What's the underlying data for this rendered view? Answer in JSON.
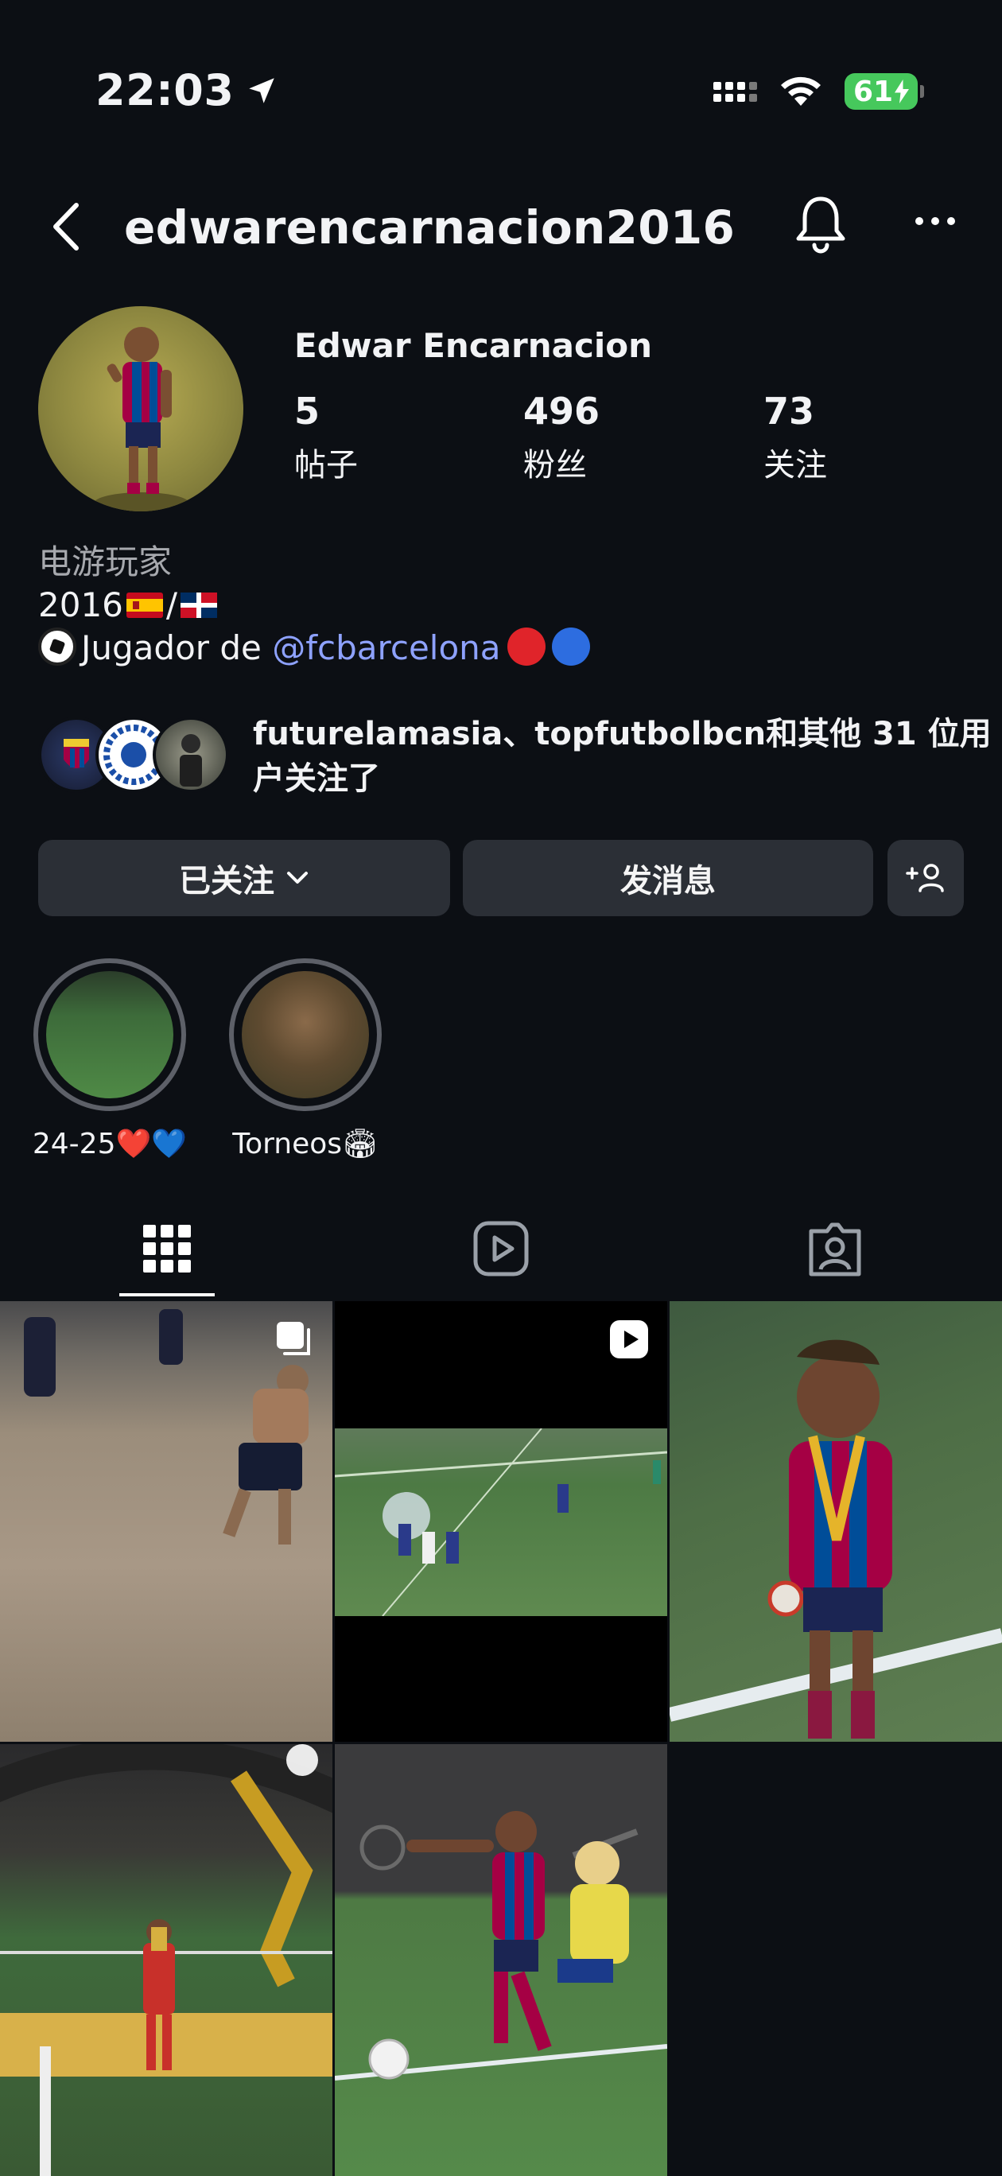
{
  "status_bar": {
    "time": "22:03",
    "battery": "61"
  },
  "header": {
    "username": "edwarencarnacion2016"
  },
  "profile": {
    "display_name": "Edwar Encarnacion",
    "stats": [
      {
        "value": "5",
        "label": "帖子"
      },
      {
        "value": "496",
        "label": "粉丝"
      },
      {
        "value": "73",
        "label": "关注"
      }
    ],
    "bio": {
      "category": "电游玩家",
      "line1_text": "2016",
      "line1_sep": "/",
      "line2_text": "Jugador de ",
      "mention": "@fcbarcelona"
    },
    "followed_by": {
      "names": "futurelamasia、topfutbolbcn",
      "rest": "和其他 31 位用户关注了"
    }
  },
  "actions": {
    "following_label": "已关注",
    "message_label": "发消息"
  },
  "highlights": [
    {
      "label": "24-25❤️💙"
    },
    {
      "label": "Torneos🏟"
    }
  ],
  "colors": {
    "background": "#0c0f14",
    "button": "#2b2f36",
    "link": "#8ea2ff",
    "battery": "#46c85c"
  }
}
